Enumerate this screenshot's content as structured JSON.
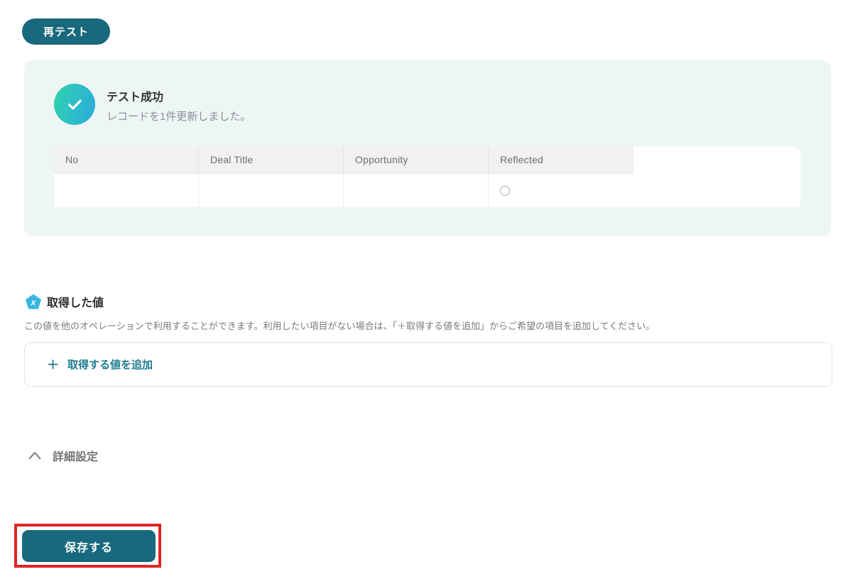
{
  "colors": {
    "primary_teal": "#19697e",
    "panel_mint": "#edf6f4",
    "success_gradient_start": "#2fd3ae",
    "success_gradient_end": "#2baade",
    "link_teal": "#1b7b91",
    "pentagon_blue": "#38b6e3",
    "highlight_red": "#e02424",
    "table_header_bg": "#f1f1ef"
  },
  "retest_button": {
    "label": "再テスト"
  },
  "test_result_panel": {
    "status_title": "テスト成功",
    "status_message": "レコードを1件更新しました。",
    "table": {
      "columns": [
        "No",
        "Deal Title",
        "Opportunity",
        "Reflected"
      ],
      "row": {
        "no": "",
        "deal_title": "",
        "opportunity": "",
        "reflected_radio_state": "unselected"
      }
    }
  },
  "obtained_values": {
    "icon_glyph": "x",
    "title": "取得した値",
    "description": "この値を他のオペレーションで利用することができます。利用したい項目がない場合は、「＋取得する値を追加」からご希望の項目を追加してください。",
    "add_label": "取得する値を追加"
  },
  "advanced_settings": {
    "label": "詳細設定",
    "state": "expanded"
  },
  "save_button": {
    "label": "保存する",
    "highlighted": true
  }
}
